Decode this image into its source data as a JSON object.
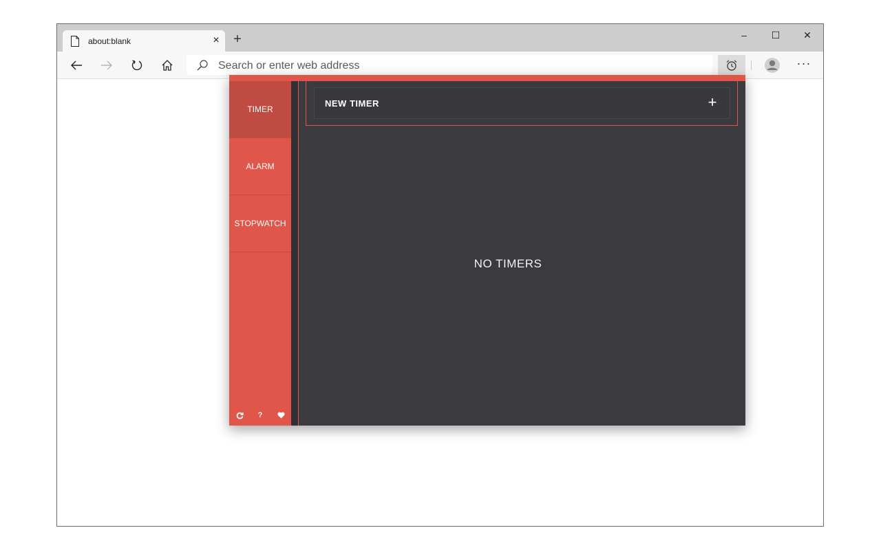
{
  "browser": {
    "tab": {
      "title": "about:blank",
      "close_glyph": "×"
    },
    "new_tab_glyph": "+",
    "window_controls": {
      "minimize": "–",
      "maximize": "☐",
      "close": "✕"
    },
    "address_bar": {
      "placeholder": "Search or enter web address",
      "value": ""
    },
    "menu_glyph": "···",
    "icons": [
      "page-icon",
      "back-icon",
      "forward-icon",
      "refresh-icon",
      "home-icon",
      "search-icon",
      "alarm-clock-icon",
      "profile-icon"
    ]
  },
  "popup": {
    "accent_color": "#e0564a",
    "background_color": "#3b3a3e",
    "nav": [
      {
        "label": "TIMER",
        "active": true
      },
      {
        "label": "ALARM",
        "active": false
      },
      {
        "label": "STOPWATCH",
        "active": false
      }
    ],
    "footer_icons": [
      {
        "name": "refresh-icon",
        "glyph": "C"
      },
      {
        "name": "help-icon",
        "glyph": "?"
      },
      {
        "name": "heart-icon",
        "glyph": "❤"
      }
    ],
    "new_timer": {
      "label": "NEW TIMER",
      "plus_glyph": "+"
    },
    "empty_message": "NO TIMERS"
  }
}
